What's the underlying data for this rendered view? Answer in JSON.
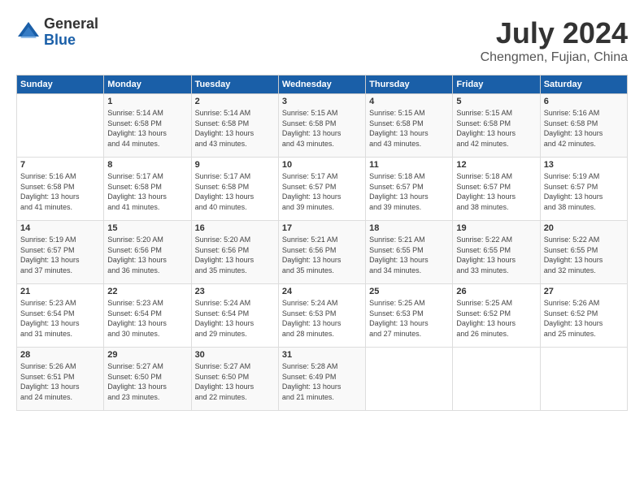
{
  "logo": {
    "general": "General",
    "blue": "Blue"
  },
  "title": "July 2024",
  "location": "Chengmen, Fujian, China",
  "weekdays": [
    "Sunday",
    "Monday",
    "Tuesday",
    "Wednesday",
    "Thursday",
    "Friday",
    "Saturday"
  ],
  "weeks": [
    [
      {
        "day": "",
        "content": ""
      },
      {
        "day": "1",
        "content": "Sunrise: 5:14 AM\nSunset: 6:58 PM\nDaylight: 13 hours\nand 44 minutes."
      },
      {
        "day": "2",
        "content": "Sunrise: 5:14 AM\nSunset: 6:58 PM\nDaylight: 13 hours\nand 43 minutes."
      },
      {
        "day": "3",
        "content": "Sunrise: 5:15 AM\nSunset: 6:58 PM\nDaylight: 13 hours\nand 43 minutes."
      },
      {
        "day": "4",
        "content": "Sunrise: 5:15 AM\nSunset: 6:58 PM\nDaylight: 13 hours\nand 43 minutes."
      },
      {
        "day": "5",
        "content": "Sunrise: 5:15 AM\nSunset: 6:58 PM\nDaylight: 13 hours\nand 42 minutes."
      },
      {
        "day": "6",
        "content": "Sunrise: 5:16 AM\nSunset: 6:58 PM\nDaylight: 13 hours\nand 42 minutes."
      }
    ],
    [
      {
        "day": "7",
        "content": "Sunrise: 5:16 AM\nSunset: 6:58 PM\nDaylight: 13 hours\nand 41 minutes."
      },
      {
        "day": "8",
        "content": "Sunrise: 5:17 AM\nSunset: 6:58 PM\nDaylight: 13 hours\nand 41 minutes."
      },
      {
        "day": "9",
        "content": "Sunrise: 5:17 AM\nSunset: 6:58 PM\nDaylight: 13 hours\nand 40 minutes."
      },
      {
        "day": "10",
        "content": "Sunrise: 5:17 AM\nSunset: 6:57 PM\nDaylight: 13 hours\nand 39 minutes."
      },
      {
        "day": "11",
        "content": "Sunrise: 5:18 AM\nSunset: 6:57 PM\nDaylight: 13 hours\nand 39 minutes."
      },
      {
        "day": "12",
        "content": "Sunrise: 5:18 AM\nSunset: 6:57 PM\nDaylight: 13 hours\nand 38 minutes."
      },
      {
        "day": "13",
        "content": "Sunrise: 5:19 AM\nSunset: 6:57 PM\nDaylight: 13 hours\nand 38 minutes."
      }
    ],
    [
      {
        "day": "14",
        "content": "Sunrise: 5:19 AM\nSunset: 6:57 PM\nDaylight: 13 hours\nand 37 minutes."
      },
      {
        "day": "15",
        "content": "Sunrise: 5:20 AM\nSunset: 6:56 PM\nDaylight: 13 hours\nand 36 minutes."
      },
      {
        "day": "16",
        "content": "Sunrise: 5:20 AM\nSunset: 6:56 PM\nDaylight: 13 hours\nand 35 minutes."
      },
      {
        "day": "17",
        "content": "Sunrise: 5:21 AM\nSunset: 6:56 PM\nDaylight: 13 hours\nand 35 minutes."
      },
      {
        "day": "18",
        "content": "Sunrise: 5:21 AM\nSunset: 6:55 PM\nDaylight: 13 hours\nand 34 minutes."
      },
      {
        "day": "19",
        "content": "Sunrise: 5:22 AM\nSunset: 6:55 PM\nDaylight: 13 hours\nand 33 minutes."
      },
      {
        "day": "20",
        "content": "Sunrise: 5:22 AM\nSunset: 6:55 PM\nDaylight: 13 hours\nand 32 minutes."
      }
    ],
    [
      {
        "day": "21",
        "content": "Sunrise: 5:23 AM\nSunset: 6:54 PM\nDaylight: 13 hours\nand 31 minutes."
      },
      {
        "day": "22",
        "content": "Sunrise: 5:23 AM\nSunset: 6:54 PM\nDaylight: 13 hours\nand 30 minutes."
      },
      {
        "day": "23",
        "content": "Sunrise: 5:24 AM\nSunset: 6:54 PM\nDaylight: 13 hours\nand 29 minutes."
      },
      {
        "day": "24",
        "content": "Sunrise: 5:24 AM\nSunset: 6:53 PM\nDaylight: 13 hours\nand 28 minutes."
      },
      {
        "day": "25",
        "content": "Sunrise: 5:25 AM\nSunset: 6:53 PM\nDaylight: 13 hours\nand 27 minutes."
      },
      {
        "day": "26",
        "content": "Sunrise: 5:25 AM\nSunset: 6:52 PM\nDaylight: 13 hours\nand 26 minutes."
      },
      {
        "day": "27",
        "content": "Sunrise: 5:26 AM\nSunset: 6:52 PM\nDaylight: 13 hours\nand 25 minutes."
      }
    ],
    [
      {
        "day": "28",
        "content": "Sunrise: 5:26 AM\nSunset: 6:51 PM\nDaylight: 13 hours\nand 24 minutes."
      },
      {
        "day": "29",
        "content": "Sunrise: 5:27 AM\nSunset: 6:50 PM\nDaylight: 13 hours\nand 23 minutes."
      },
      {
        "day": "30",
        "content": "Sunrise: 5:27 AM\nSunset: 6:50 PM\nDaylight: 13 hours\nand 22 minutes."
      },
      {
        "day": "31",
        "content": "Sunrise: 5:28 AM\nSunset: 6:49 PM\nDaylight: 13 hours\nand 21 minutes."
      },
      {
        "day": "",
        "content": ""
      },
      {
        "day": "",
        "content": ""
      },
      {
        "day": "",
        "content": ""
      }
    ]
  ]
}
